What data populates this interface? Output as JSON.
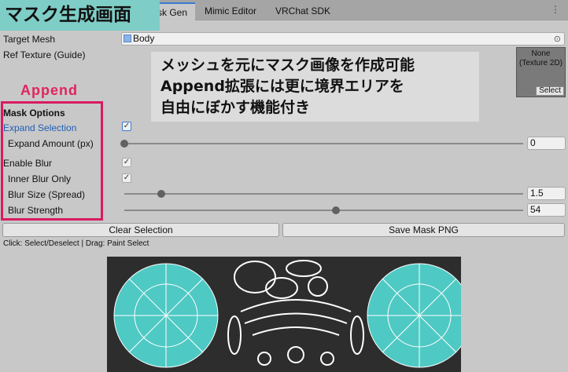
{
  "tabs": [
    {
      "label": "sk Gen",
      "active": true
    },
    {
      "label": "Mimic Editor"
    },
    {
      "label": "VRChat SDK"
    }
  ],
  "title_badge": "マスク生成画面",
  "target_mesh": {
    "label": "Target Mesh",
    "value": "Body"
  },
  "ref_texture": {
    "label": "Ref Texture (Guide)",
    "value": "None",
    "type": "(Texture 2D)",
    "select": "Select"
  },
  "callout": [
    "メッシュを元にマスク画像を作成可能",
    "Append拡張には更に境界エリアを",
    "自由にぼかす機能付き"
  ],
  "append_label": "Append",
  "mask_options": {
    "header": "Mask Options",
    "expand_selection": {
      "label": "Expand Selection",
      "checked": true
    },
    "expand_amount": {
      "label": "Expand Amount (px)",
      "value": "0",
      "fraction": 0
    },
    "enable_blur": {
      "label": "Enable Blur",
      "checked": true
    },
    "inner_blur_only": {
      "label": "Inner Blur Only",
      "checked": true
    },
    "blur_size": {
      "label": "Blur Size (Spread)",
      "value": "1.5",
      "fraction": 0.093
    },
    "blur_strength": {
      "label": "Blur Strength",
      "value": "54",
      "fraction": 0.53
    }
  },
  "buttons": {
    "clear": "Clear Selection",
    "save": "Save Mask PNG"
  },
  "hint": "Click: Select/Deselect | Drag: Paint Select",
  "colors": {
    "accent": "#3a79d1",
    "highlight": "#d81b60",
    "badge": "#7fcdc7",
    "mesh_teal": "#4fc9c4"
  }
}
